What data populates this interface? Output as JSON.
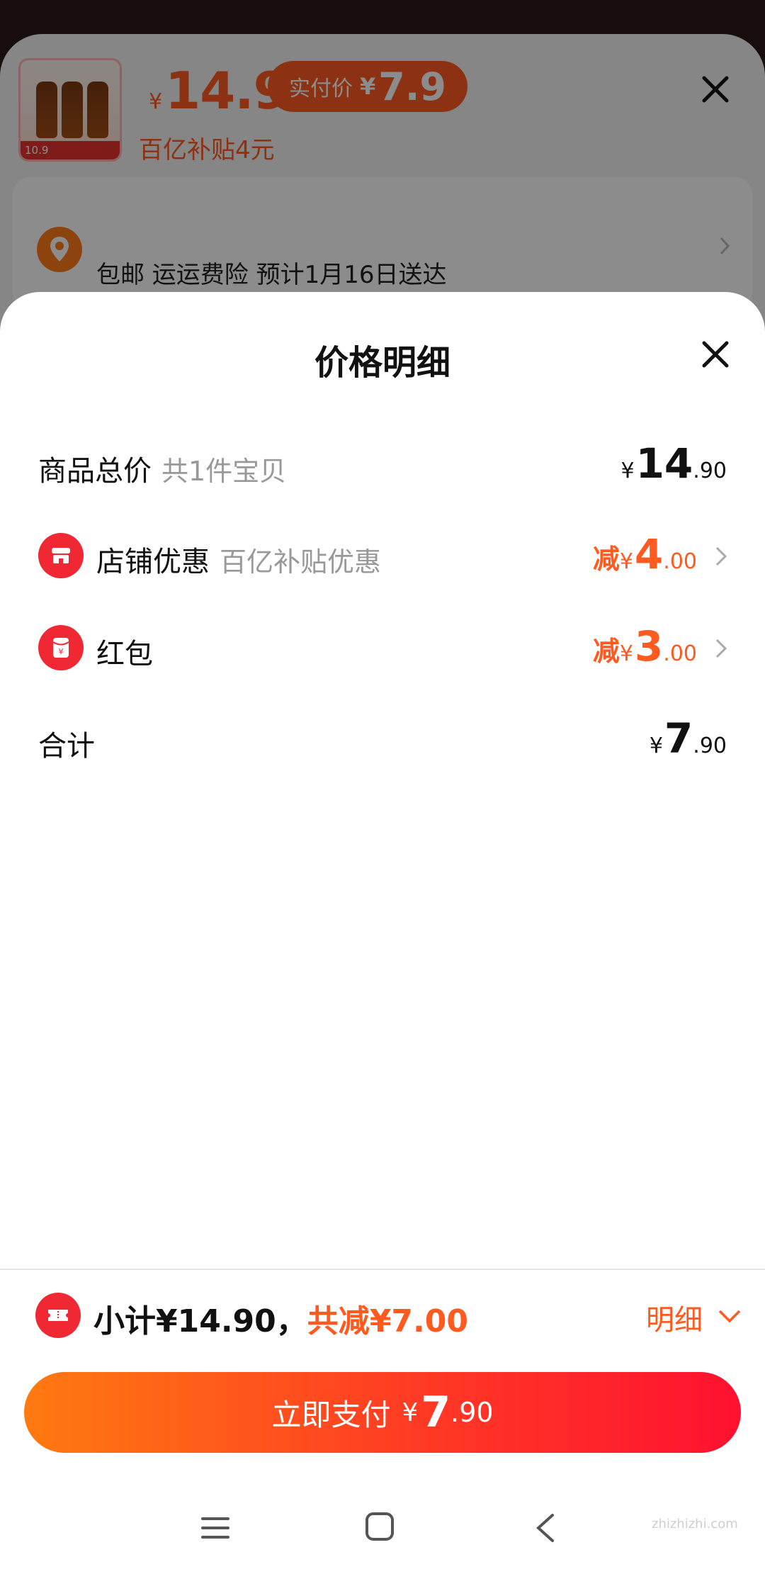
{
  "background": {
    "price": "14.9",
    "currency": "¥",
    "paid_label": "实付价",
    "paid_price": "7.9",
    "subsidy_text": "百亿补贴4元",
    "thumbnail_badge": "10.9",
    "address_line": "包邮 运运费险 预计1月16日送达"
  },
  "sheet": {
    "title": "价格明细",
    "rows": [
      {
        "label": "商品总价",
        "sub": "共1件宝贝",
        "prefix": "",
        "currency": "¥",
        "int": "14",
        "dec": ".90"
      },
      {
        "label": "店铺优惠",
        "sub": "百亿补贴优惠",
        "prefix": "减",
        "currency": "¥",
        "int": "4",
        "dec": ".00"
      },
      {
        "label": "红包",
        "sub": "",
        "prefix": "减",
        "currency": "¥",
        "int": "3",
        "dec": ".00"
      },
      {
        "label": "合计",
        "sub": "",
        "prefix": "",
        "currency": "¥",
        "int": "7",
        "dec": ".90"
      }
    ]
  },
  "summary": {
    "subtotal": "小计¥14.90，",
    "discount": "共减¥7.00",
    "detail": "明细"
  },
  "pay": {
    "label": "立即支付",
    "currency": "¥",
    "int": "7",
    "dec": ".90"
  },
  "watermark": "zhizhizhi.com",
  "colors": {
    "accent": "#ff5a1f",
    "brand_red": "#f02833",
    "pay_gradient_start": "#ff7a10",
    "pay_gradient_end": "#ff1130"
  }
}
